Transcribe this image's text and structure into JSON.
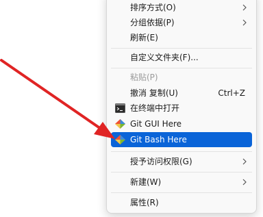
{
  "menu": {
    "items": [
      {
        "label": "排序方式(O)"
      },
      {
        "label": "分组依据(P)"
      },
      {
        "label": "刷新(E)"
      },
      {
        "label": "自定义文件夹(F)..."
      },
      {
        "label": "粘贴(P)"
      },
      {
        "label": "撤消 复制(U)",
        "shortcut": "Ctrl+Z"
      },
      {
        "label": "在终端中打开"
      },
      {
        "label": "Git GUI Here"
      },
      {
        "label": "Git Bash Here"
      },
      {
        "label": "授予访问权限(G)"
      },
      {
        "label": "新建(W)"
      },
      {
        "label": "属性(R)"
      }
    ]
  },
  "colors": {
    "selection": "#0a64d8",
    "annotation_arrow": "#e02424",
    "menu_bg": "#f9f9f9"
  },
  "icons": [
    "chevron-right-icon",
    "terminal-icon",
    "git-diamond-icon"
  ]
}
